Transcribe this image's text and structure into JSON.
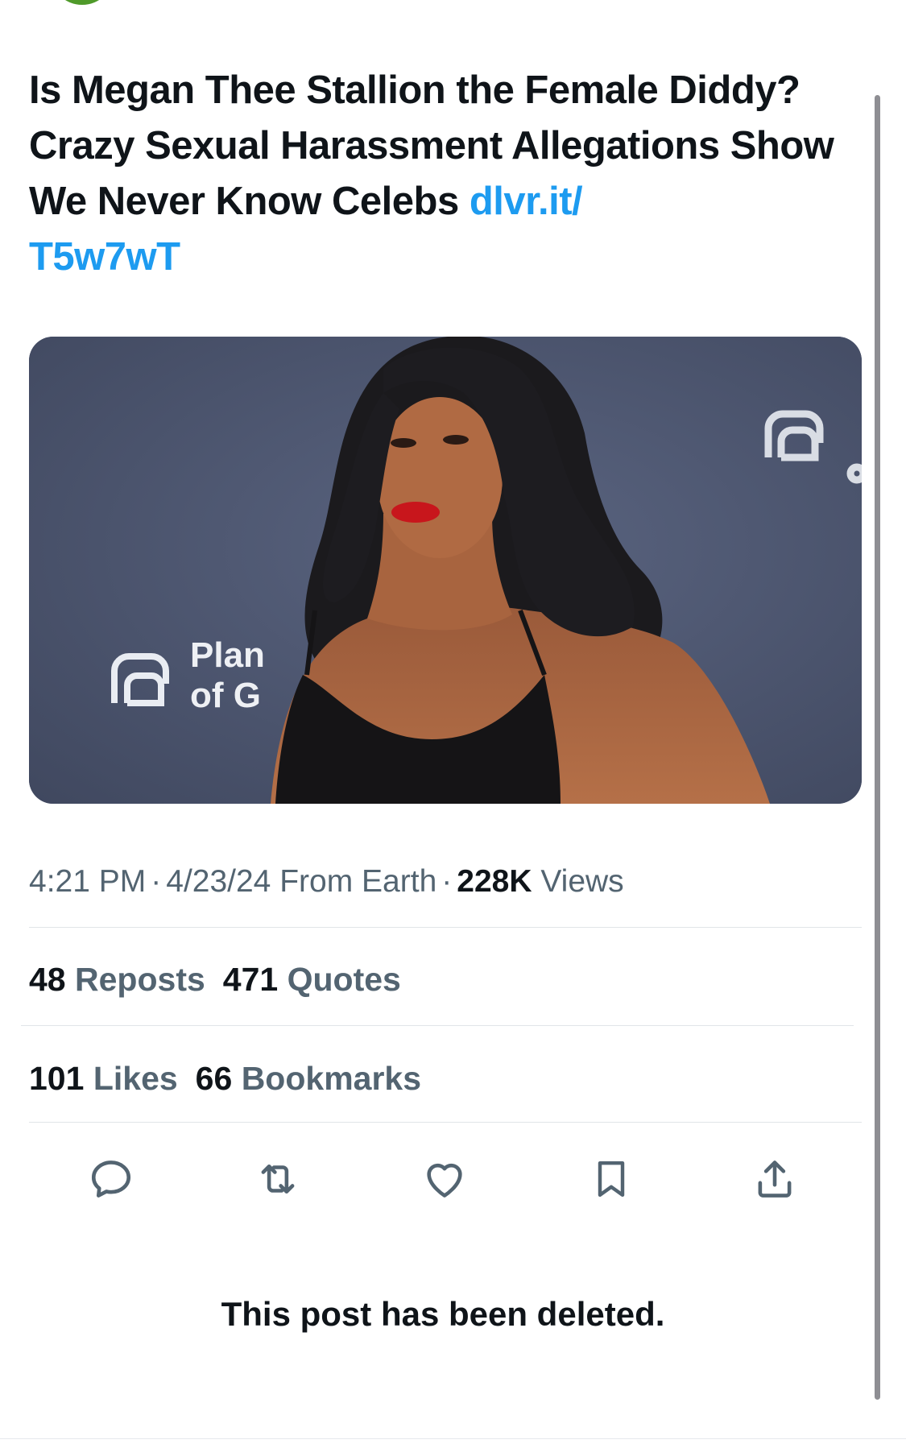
{
  "tweet": {
    "text": "Is Megan Thee Stallion the Female Diddy? Crazy Sexual Harassment Allegations Show We Never Know Celebs ",
    "link": "dlvr.it/\nT5w7wT",
    "media": {
      "backdrop_logo_text_line1": "Plan",
      "backdrop_logo_text_line2": "of G"
    }
  },
  "meta": {
    "time": "4:21 PM",
    "separator": "·",
    "date": "4/23/24",
    "source": "From Earth",
    "views_count": "228K",
    "views_label": "Views"
  },
  "stats": {
    "reposts_count": "48",
    "reposts_label": "Reposts",
    "quotes_count": "471",
    "quotes_label": "Quotes",
    "likes_count": "101",
    "likes_label": "Likes",
    "bookmarks_count": "66",
    "bookmarks_label": "Bookmarks"
  },
  "actions": {
    "reply_icon": "reply-icon",
    "repost_icon": "repost-icon",
    "like_icon": "heart-icon",
    "bookmark_icon": "bookmark-icon",
    "share_icon": "share-icon",
    "icon_color": "#536471"
  },
  "notice": {
    "deleted": "This post has been deleted."
  },
  "colors": {
    "link": "#1d9bf0",
    "text": "#0f1419",
    "secondary": "#536471",
    "media_backdrop": "#4f5871"
  }
}
